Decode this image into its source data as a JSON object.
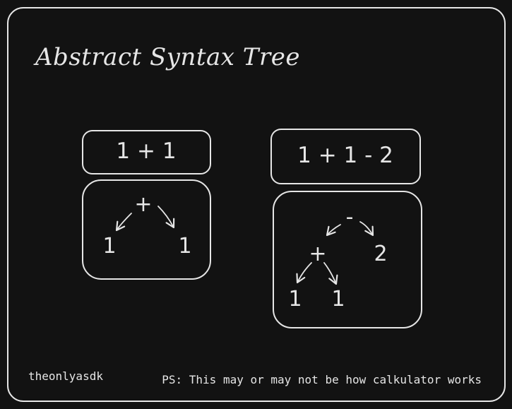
{
  "diagram": {
    "title": "Abstract Syntax Tree",
    "example_simple": {
      "expression": "1 + 1",
      "tree": {
        "root": "+",
        "left": "1",
        "right": "1"
      }
    },
    "example_complex": {
      "expression": "1 + 1 - 2",
      "tree": {
        "root": "-",
        "sub_operator": "+",
        "sub_left": "1",
        "sub_right": "1",
        "right": "2"
      }
    },
    "footer_left": "theonlyasdk",
    "footer_right": "PS: This may or may not be how calkulator works",
    "colors": {
      "background": "#121212",
      "stroke": "#e6e6e6",
      "text": "#e6e6e6"
    }
  }
}
